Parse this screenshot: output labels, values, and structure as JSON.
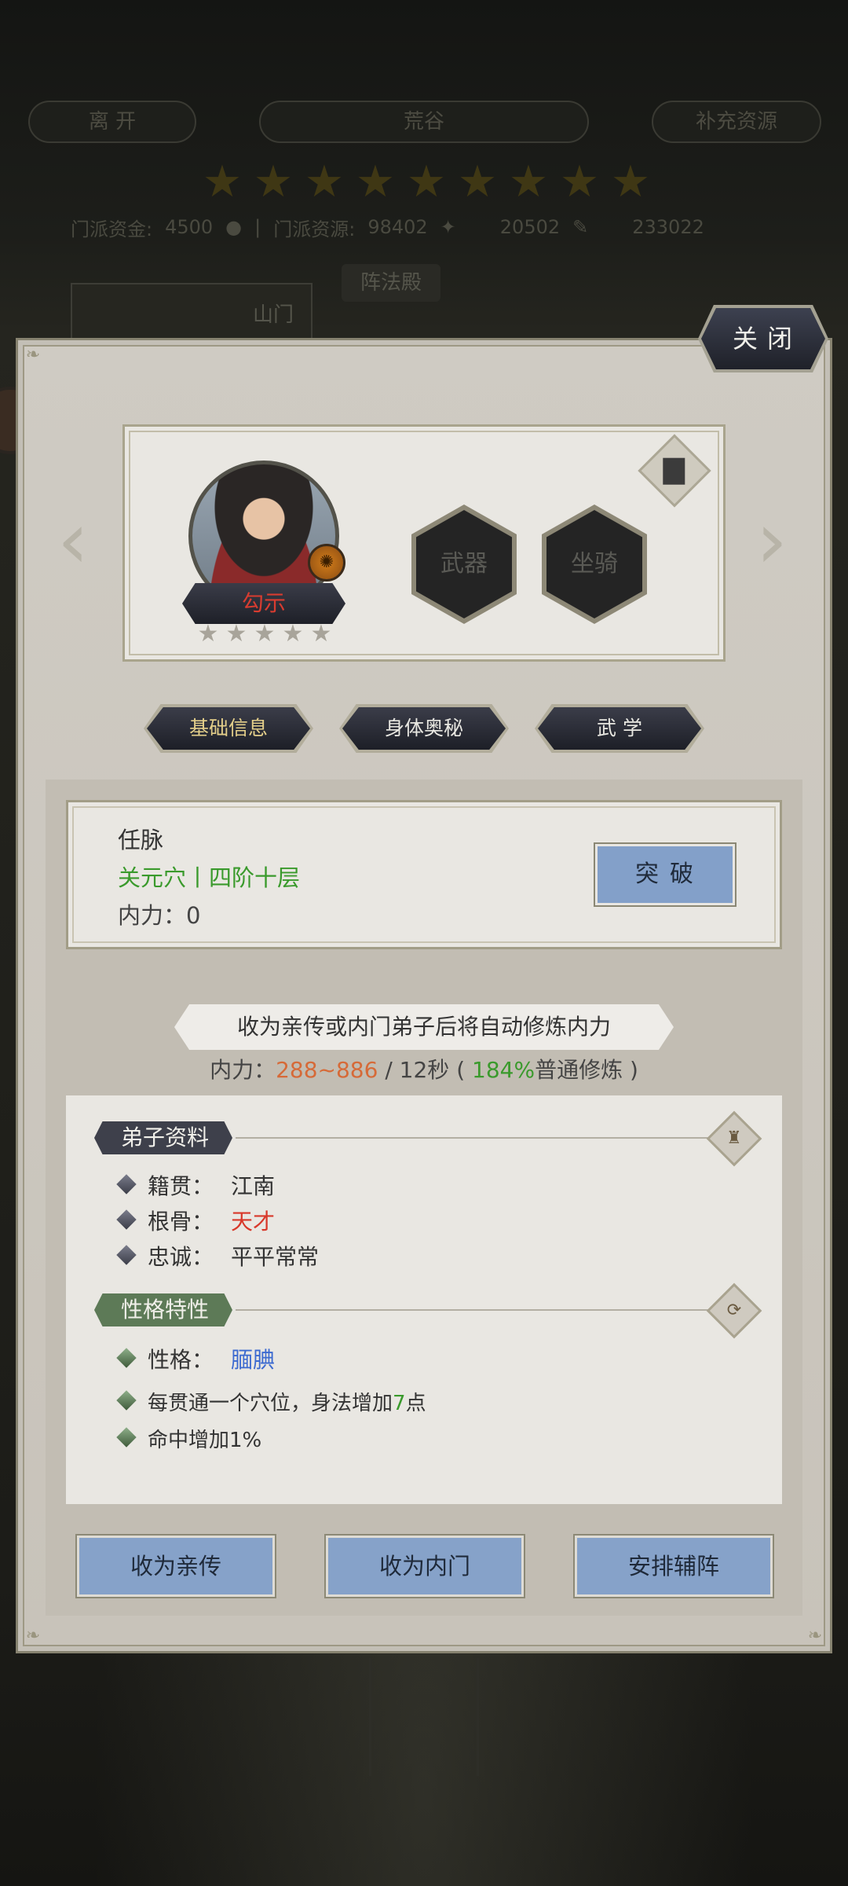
{
  "background": {
    "leave_label": "离 开",
    "location_title": "荒谷",
    "replenish_label": "补充资源",
    "sect_funds_label": "门派资金:",
    "sect_funds_value": "4500",
    "sect_resources_label": "门派资源:",
    "sect_resources_value": "98402",
    "resource_3_value": "20502",
    "resource_4_value": "233022",
    "formation_hall_label": "阵法殿",
    "mountain_gate_label": "山门",
    "stars": [
      "★",
      "★",
      "★",
      "★",
      "★",
      "★",
      "★",
      "★",
      "★"
    ]
  },
  "panel": {
    "close_label": "关闭",
    "character": {
      "name": "勾示",
      "stars": [
        "★",
        "★",
        "★",
        "★",
        "★"
      ],
      "weapon_slot": "武器",
      "mount_slot": "坐骑"
    },
    "tabs": [
      {
        "label": "基础信息",
        "active": true
      },
      {
        "label": "身体奥秘",
        "active": false
      },
      {
        "label": "武 学",
        "active": false
      }
    ],
    "meridian": {
      "title": "任脉",
      "level": "关元穴丨四阶十层",
      "power": "内力：0",
      "breakthrough_label": "突破"
    },
    "cultivation": {
      "notice": "收为亲传或内门弟子后将自动修炼内力",
      "rate_prefix": "内力：",
      "rate_range": "288~886",
      "rate_mid": " / 12秒 ( ",
      "rate_percent": "184%",
      "rate_suffix": "普通修炼 )"
    },
    "disciple_info": {
      "section_title": "弟子资料",
      "rows": [
        {
          "label": "籍贯：",
          "value": "江南"
        },
        {
          "label": "根骨：",
          "value": "天才"
        },
        {
          "label": "忠诚：",
          "value": "平平常常"
        }
      ]
    },
    "personality": {
      "section_title": "性格特性",
      "trait_label": "性格：",
      "trait_value": "腼腆",
      "effect_1_prefix": "每贯通一个穴位，身法增加",
      "effect_1_number": "7",
      "effect_1_suffix": "点",
      "effect_2": "命中增加1%"
    },
    "actions": {
      "direct_disciple": "收为亲传",
      "inner_disciple": "收为内门",
      "assign_formation": "安排辅阵"
    }
  },
  "colors": {
    "accent_blue_button": "#86a2c9",
    "green_text": "#3a9a2c",
    "red_text": "#d8382a",
    "blue_text": "#3c6ad0",
    "orange_text": "#d66a38"
  }
}
